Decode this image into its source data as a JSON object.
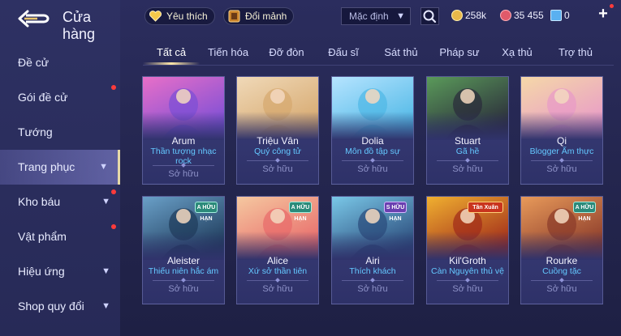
{
  "header": {
    "title": "Cửa hàng",
    "favorites_label": "Yêu thích",
    "exchange_label": "Đổi mảnh",
    "sort_value": "Mặc định",
    "gold": "258k",
    "diamonds": "35 455",
    "vouchers": "0"
  },
  "sidebar": {
    "items": [
      {
        "label": "Đề cử",
        "chevron": false,
        "dot": false
      },
      {
        "label": "Gói đề cử",
        "chevron": false,
        "dot": true
      },
      {
        "label": "Tướng",
        "chevron": false,
        "dot": false
      },
      {
        "label": "Trang phục",
        "chevron": true,
        "dot": false,
        "active": true
      },
      {
        "label": "Kho báu",
        "chevron": true,
        "dot": true
      },
      {
        "label": "Vật phẩm",
        "chevron": false,
        "dot": true
      },
      {
        "label": "Hiệu ứng",
        "chevron": true,
        "dot": false
      },
      {
        "label": "Shop quy đổi",
        "chevron": true,
        "dot": false
      }
    ]
  },
  "tabs": [
    "Tất cả",
    "Tiến hóa",
    "Đỡ đòn",
    "Đấu sĩ",
    "Sát thủ",
    "Pháp sư",
    "Xạ thủ",
    "Trợ thủ"
  ],
  "cards": [
    {
      "hero": "Arum",
      "skin": "Thần tượng nhạc rock",
      "status": "Sở hữu",
      "badge": "",
      "colors": [
        "#7b4fd6",
        "#e86fc8"
      ]
    },
    {
      "hero": "Triệu Vân",
      "skin": "Quý công tử",
      "status": "Sở hữu",
      "badge": "",
      "colors": [
        "#d6a86e",
        "#f0d9b8"
      ]
    },
    {
      "hero": "Dolia",
      "skin": "Môn đồ tập sự",
      "status": "Sở hữu",
      "badge": "",
      "colors": [
        "#4fb8e6",
        "#b6e4ff"
      ]
    },
    {
      "hero": "Stuart",
      "skin": "Gã hề",
      "status": "Sở hữu",
      "badge": "",
      "colors": [
        "#2a2a3a",
        "#5a9a5a"
      ]
    },
    {
      "hero": "Qi",
      "skin": "Blogger Ẩm thực",
      "status": "Sở hữu",
      "badge": "",
      "colors": [
        "#e89ac8",
        "#f5d8a8"
      ]
    },
    {
      "hero": "Aleister",
      "skin": "Thiếu niên hắc ám",
      "status": "Sở hữu",
      "badge": "A HỮU HẠN",
      "colors": [
        "#1e3a5a",
        "#6aa0c8"
      ]
    },
    {
      "hero": "Alice",
      "skin": "Xứ sở thần tiên",
      "status": "Sở hữu",
      "badge": "A HỮU HẠN",
      "colors": [
        "#e86a6a",
        "#f5c8a0"
      ]
    },
    {
      "hero": "Airi",
      "skin": "Thích khách",
      "status": "Sở hữu",
      "badge": "S HỮU HẠN",
      "colors": [
        "#2a4a7a",
        "#7ac8e8"
      ]
    },
    {
      "hero": "Kil'Groth",
      "skin": "Càn Nguyên thủ vệ",
      "status": "Sở hữu",
      "badge": "Tân Xuân",
      "colors": [
        "#a02a1a",
        "#f0b030"
      ]
    },
    {
      "hero": "Rourke",
      "skin": "Cuồng tặc",
      "status": "Sở hữu",
      "badge": "A HỮU HẠN",
      "colors": [
        "#8a3a2a",
        "#e89a5a"
      ]
    }
  ]
}
